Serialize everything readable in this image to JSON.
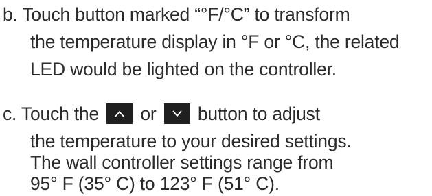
{
  "step_b": {
    "line1": "b. Touch button marked “°F/°C” to transform",
    "line2": "the temperature display in °F or °C, the related",
    "line3": "LED would be lighted on the controller."
  },
  "step_c": {
    "line1_prefix": "c. Touch the",
    "line1_or": "or",
    "line1_suffix": "button to adjust",
    "up_button_icon": "chevron-up-icon",
    "down_button_icon": "chevron-down-icon",
    "line2": "the temperature to your desired settings.",
    "line3": "The wall controller settings range from",
    "line4": "95° F (35° C) to 123° F (51° C)."
  }
}
